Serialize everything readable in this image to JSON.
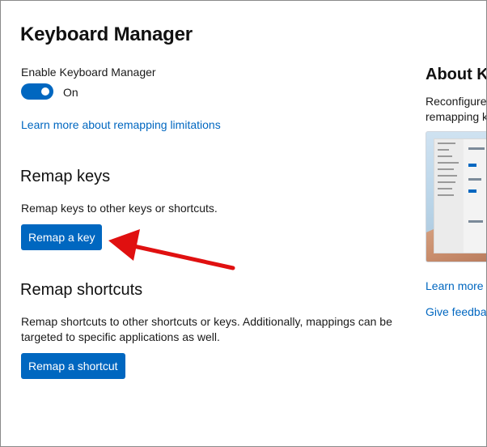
{
  "page": {
    "title": "Keyboard Manager"
  },
  "enable": {
    "label": "Enable Keyboard Manager",
    "state": "On",
    "enabled": true
  },
  "links": {
    "limitations": "Learn more about remapping limitations"
  },
  "remap_keys": {
    "title": "Remap keys",
    "description": "Remap keys to other keys or shortcuts.",
    "button": "Remap a key"
  },
  "remap_shortcuts": {
    "title": "Remap shortcuts",
    "description": "Remap shortcuts to other shortcuts or keys. Additionally, mappings can be targeted to specific applications as well.",
    "button": "Remap a shortcut"
  },
  "about": {
    "title": "About Ke",
    "description_line1": "Reconfigure",
    "description_line2": "remapping k",
    "learn_more": "Learn more",
    "feedback": "Give feedba"
  },
  "colors": {
    "accent": "#0067c0",
    "annotation_arrow": "#e01010"
  }
}
